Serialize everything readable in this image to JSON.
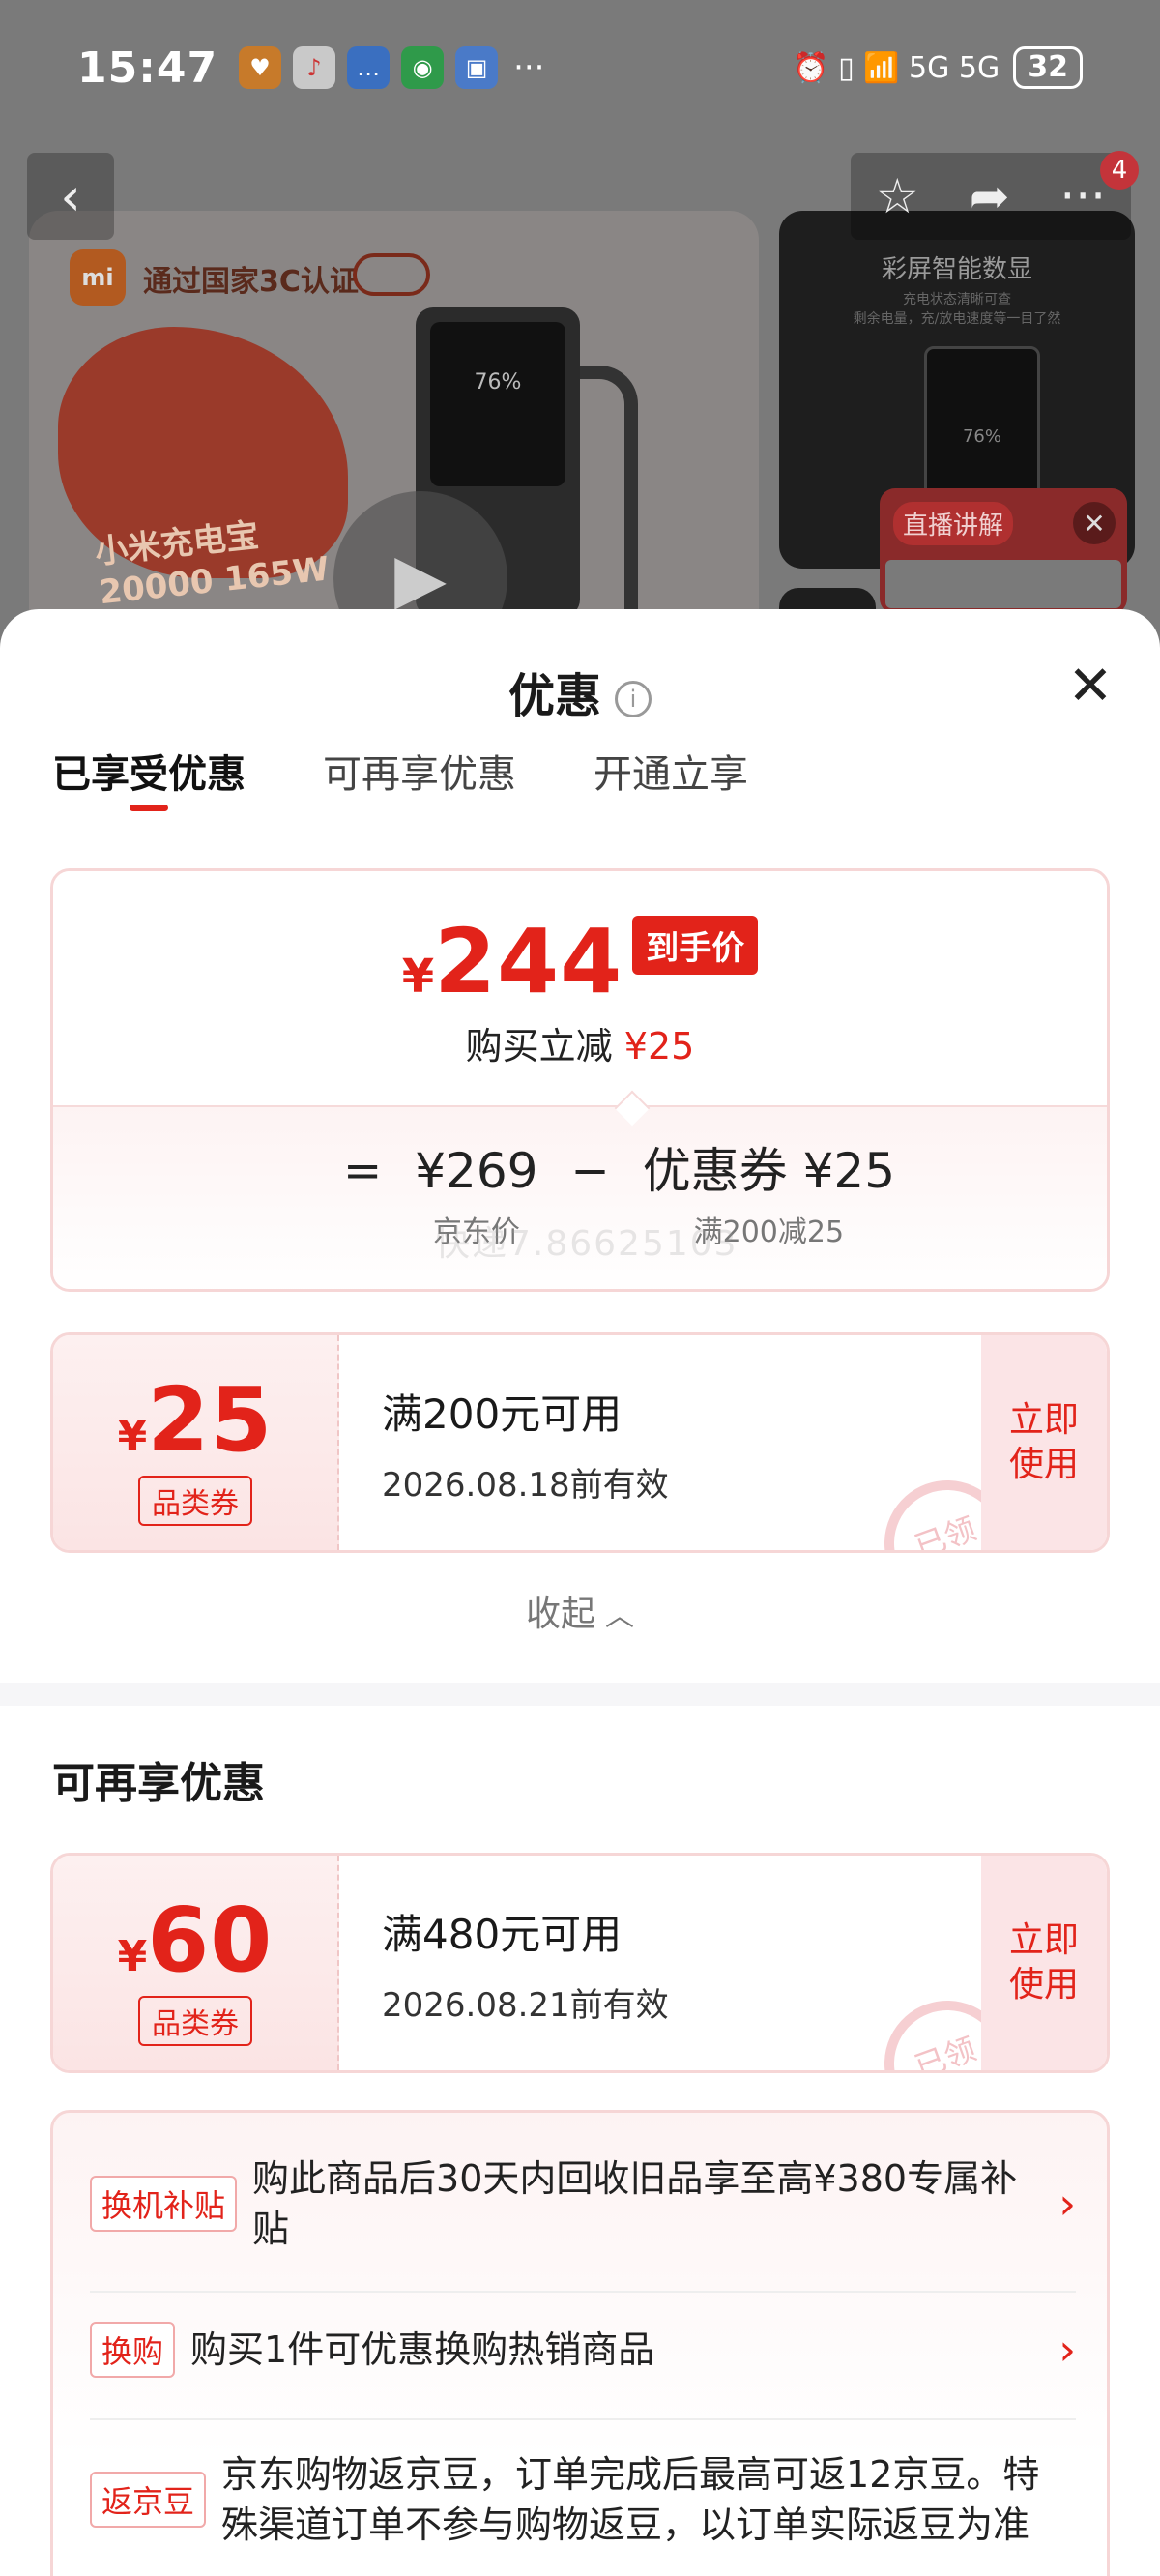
{
  "status_bar": {
    "time": "15:47",
    "more": "···",
    "right_icons": "⏰ ▯ 📶 5G 5G",
    "battery": "32"
  },
  "background": {
    "certification": "通过国家3C认证",
    "mi_logo": "mi",
    "product_name_line1": "小米充电宝",
    "product_name_line2": "20000 165W",
    "screen_percent": "76%",
    "side_title": "彩屏智能数显",
    "side_sub": "充电状态清晰可查\n剩余电量，充/放电速度等一目了然",
    "side_percent": "76%",
    "live_label": "直播讲解",
    "nav_badge": "4"
  },
  "sheet": {
    "title": "优惠",
    "tabs": [
      "已享受优惠",
      "可再享优惠",
      "开通立享"
    ],
    "price": {
      "currency": "¥",
      "final": "244",
      "tag": "到手价",
      "saving_label": "购买立减",
      "saving_value": "¥25",
      "equals": "=",
      "minus": "−",
      "base_value": "¥269",
      "base_label": "京东价",
      "coupon_label_value": "优惠券 ¥25",
      "coupon_rule": "满200减25",
      "watermark": "快递7.86625103"
    },
    "applied_coupon": {
      "currency": "¥",
      "amount": "25",
      "type": "品类券",
      "condition": "满200元可用",
      "expiry": "2026.08.18前有效",
      "action": "立即使用",
      "stamp": "已领"
    },
    "collapse_label": "收起",
    "more_section_title": "可再享优惠",
    "more_coupon": {
      "currency": "¥",
      "amount": "60",
      "type": "品类券",
      "condition": "满480元可用",
      "expiry": "2026.08.21前有效",
      "action": "立即使用",
      "stamp": "已领"
    },
    "promos": [
      {
        "tag": "换机补贴",
        "text": "购此商品后30天内回收旧品享至高¥380专属补贴"
      },
      {
        "tag": "换购",
        "text": "购买1件可优惠换购热销商品"
      },
      {
        "tag": "返京豆",
        "text": "京东购物返京豆，订单完成后最高可返12京豆。特殊渠道订单不参与购物返豆，以订单实际返豆为准"
      }
    ]
  }
}
